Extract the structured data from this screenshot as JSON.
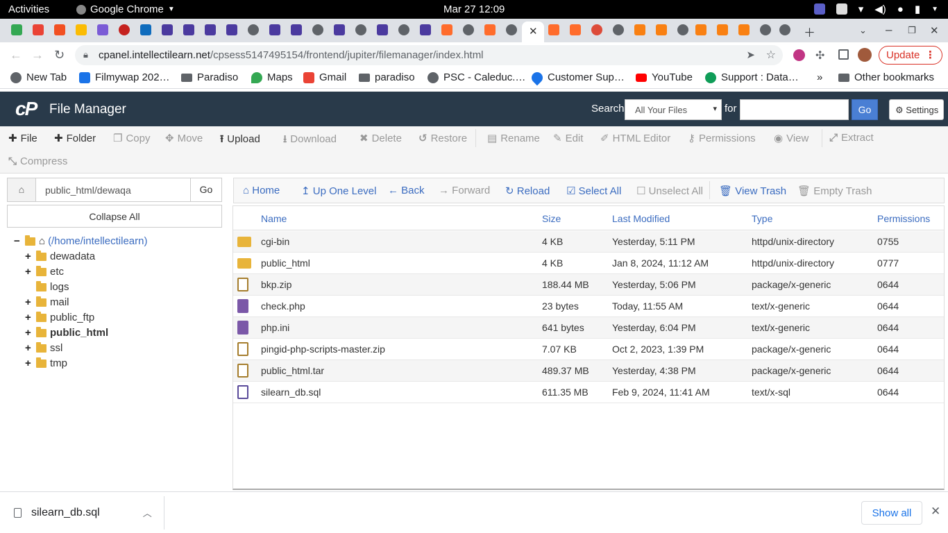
{
  "os_bar": {
    "activities": "Activities",
    "app_name": "Google Chrome",
    "clock": "Mar 27  12:09"
  },
  "browser": {
    "url_host": "cpanel.intellectilearn.net",
    "url_path": "/cpsess5147495154/frontend/jupiter/filemanager/index.html",
    "update_label": "Update",
    "bookmarks": [
      {
        "label": "New Tab",
        "icon": "globe-icon"
      },
      {
        "label": "Filmywap 202…",
        "icon": "f-icon"
      },
      {
        "label": "Paradiso",
        "icon": "folder-icon"
      },
      {
        "label": "Maps",
        "icon": "maps-icon"
      },
      {
        "label": "Gmail",
        "icon": "gmail-icon"
      },
      {
        "label": "paradiso",
        "icon": "folder-icon"
      },
      {
        "label": "PSC - Caleduc.…",
        "icon": "globe-icon"
      },
      {
        "label": "Customer Sup…",
        "icon": "drop-icon"
      },
      {
        "label": "YouTube",
        "icon": "youtube-icon"
      },
      {
        "label": "Support : Data…",
        "icon": "support-icon"
      }
    ],
    "bookmarks_more": "»",
    "other_bookmarks": "Other bookmarks"
  },
  "header": {
    "logo": "cP",
    "title": "File Manager",
    "search_label": "Search",
    "search_scope": "All Your Files",
    "for_label": "for",
    "search_value": "",
    "go_label": "Go",
    "settings_label": "Settings"
  },
  "toolbar": {
    "file": "File",
    "folder": "Folder",
    "copy": "Copy",
    "move": "Move",
    "upload": "Upload",
    "download": "Download",
    "delete": "Delete",
    "restore": "Restore",
    "rename": "Rename",
    "edit": "Edit",
    "html_editor": "HTML Editor",
    "permissions": "Permissions",
    "view": "View",
    "extract": "Extract",
    "compress": "Compress"
  },
  "sidebar": {
    "path_value": "public_html/dewaqa",
    "go_label": "Go",
    "collapse_label": "Collapse All",
    "root": "(/home/intellectilearn)",
    "items": [
      {
        "label": "dewadata",
        "expandable": true
      },
      {
        "label": "etc",
        "expandable": true
      },
      {
        "label": "logs",
        "expandable": false
      },
      {
        "label": "mail",
        "expandable": true
      },
      {
        "label": "public_ftp",
        "expandable": true
      },
      {
        "label": "public_html",
        "expandable": true
      },
      {
        "label": "ssl",
        "expandable": true
      },
      {
        "label": "tmp",
        "expandable": true
      }
    ]
  },
  "navbar": {
    "home": "Home",
    "up": "Up One Level",
    "back": "Back",
    "forward": "Forward",
    "reload": "Reload",
    "select_all": "Select All",
    "unselect_all": "Unselect All",
    "view_trash": "View Trash",
    "empty_trash": "Empty Trash"
  },
  "table": {
    "headers": [
      "Name",
      "Size",
      "Last Modified",
      "Type",
      "Permissions"
    ],
    "rows": [
      {
        "name": "cgi-bin",
        "size": "4 KB",
        "modified": "Yesterday, 5:11 PM",
        "type": "httpd/unix-directory",
        "perms": "0755",
        "icon": "folder-icon"
      },
      {
        "name": "public_html",
        "size": "4 KB",
        "modified": "Jan 8, 2024, 11:12 AM",
        "type": "httpd/unix-directory",
        "perms": "0777",
        "icon": "folder-icon"
      },
      {
        "name": "bkp.zip",
        "size": "188.44 MB",
        "modified": "Yesterday, 5:06 PM",
        "type": "package/x-generic",
        "perms": "0644",
        "icon": "zip-file-icon"
      },
      {
        "name": "check.php",
        "size": "23 bytes",
        "modified": "Today, 11:55 AM",
        "type": "text/x-generic",
        "perms": "0644",
        "icon": "text-file-icon"
      },
      {
        "name": "php.ini",
        "size": "641 bytes",
        "modified": "Yesterday, 6:04 PM",
        "type": "text/x-generic",
        "perms": "0644",
        "icon": "text-file-icon"
      },
      {
        "name": "pingid-php-scripts-master.zip",
        "size": "7.07 KB",
        "modified": "Oct 2, 2023, 1:39 PM",
        "type": "package/x-generic",
        "perms": "0644",
        "icon": "zip-file-icon"
      },
      {
        "name": "public_html.tar",
        "size": "489.37 MB",
        "modified": "Yesterday, 4:38 PM",
        "type": "package/x-generic",
        "perms": "0644",
        "icon": "zip-file-icon"
      },
      {
        "name": "silearn_db.sql",
        "size": "611.35 MB",
        "modified": "Feb 9, 2024, 11:41 AM",
        "type": "text/x-sql",
        "perms": "0644",
        "icon": "sql-file-icon"
      }
    ]
  },
  "downloads": {
    "file": "silearn_db.sql",
    "show_all": "Show all"
  },
  "colors": {
    "header_bg": "#293a4a",
    "link_blue": "#3b6cc0",
    "folder_yellow": "#e8b43a",
    "chrome_update_red": "#d93025"
  }
}
